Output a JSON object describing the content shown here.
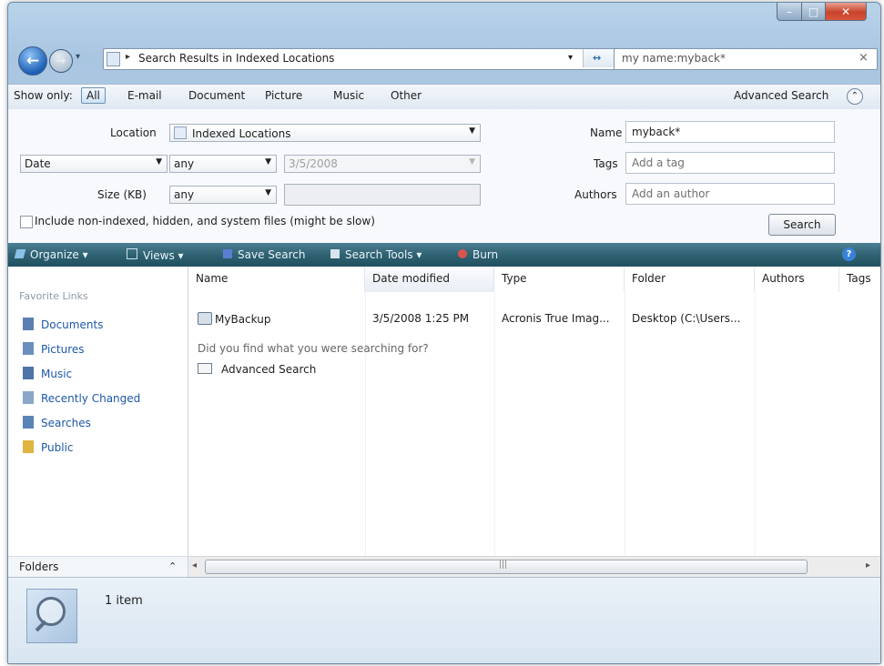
{
  "window": {
    "minimize_glyph": "–",
    "maximize_glyph": "□",
    "close_glyph": "✕"
  },
  "nav": {
    "back_glyph": "←",
    "forward_glyph": "→",
    "dropdown_glyph": "▾",
    "address_separator": "▸",
    "address_text": "Search Results in Indexed Locations",
    "search_query": "my name:myback*",
    "clear_glyph": "×"
  },
  "show_only": {
    "label": "Show only:",
    "filters": [
      "All",
      "E-mail",
      "Document",
      "Picture",
      "Music",
      "Other"
    ],
    "active": "All",
    "advanced_label": "Advanced Search",
    "advanced_glyph": "⌃"
  },
  "search_pane": {
    "location_label": "Location",
    "location_value": "Indexed Locations",
    "date_field": "Date",
    "date_op": "any",
    "date_value": "3/5/2008",
    "size_label": "Size (KB)",
    "size_op": "any",
    "size_value": "",
    "include_label": "Include non-indexed, hidden, and system files (might be slow)",
    "name_label": "Name",
    "name_value": "myback*",
    "tags_label": "Tags",
    "tags_placeholder": "Add a tag",
    "authors_label": "Authors",
    "authors_placeholder": "Add an author",
    "search_button": "Search"
  },
  "commands": {
    "organize": "Organize",
    "views": "Views",
    "save_search": "Save Search",
    "search_tools": "Search Tools",
    "burn": "Burn",
    "help_glyph": "?"
  },
  "nav_pane": {
    "header": "Favorite Links",
    "items": [
      {
        "label": "Documents",
        "color": "#5b7fb0"
      },
      {
        "label": "Pictures",
        "color": "#6a8fbf"
      },
      {
        "label": "Music",
        "color": "#4e74a8"
      },
      {
        "label": "Recently Changed",
        "color": "#8aa6c8"
      },
      {
        "label": "Searches",
        "color": "#5b84b6"
      },
      {
        "label": "Public",
        "color": "#e0b440"
      }
    ],
    "folders_label": "Folders",
    "folders_glyph": "⌃"
  },
  "file_list": {
    "columns": [
      "Name",
      "Date modified",
      "Type",
      "Folder",
      "Authors",
      "Tags"
    ],
    "rows": [
      {
        "name": "MyBackup",
        "date": "3/5/2008 1:25 PM",
        "type": "Acronis True Imag...",
        "folder": "Desktop (C:\\Users...",
        "authors": "",
        "tags": ""
      }
    ],
    "prompt": "Did you find what you were searching for?",
    "advanced_link": "Advanced Search"
  },
  "scrollbar": {
    "left_glyph": "◂",
    "right_glyph": "▸",
    "grip_glyph": "|||"
  },
  "details": {
    "count": "1 item"
  }
}
